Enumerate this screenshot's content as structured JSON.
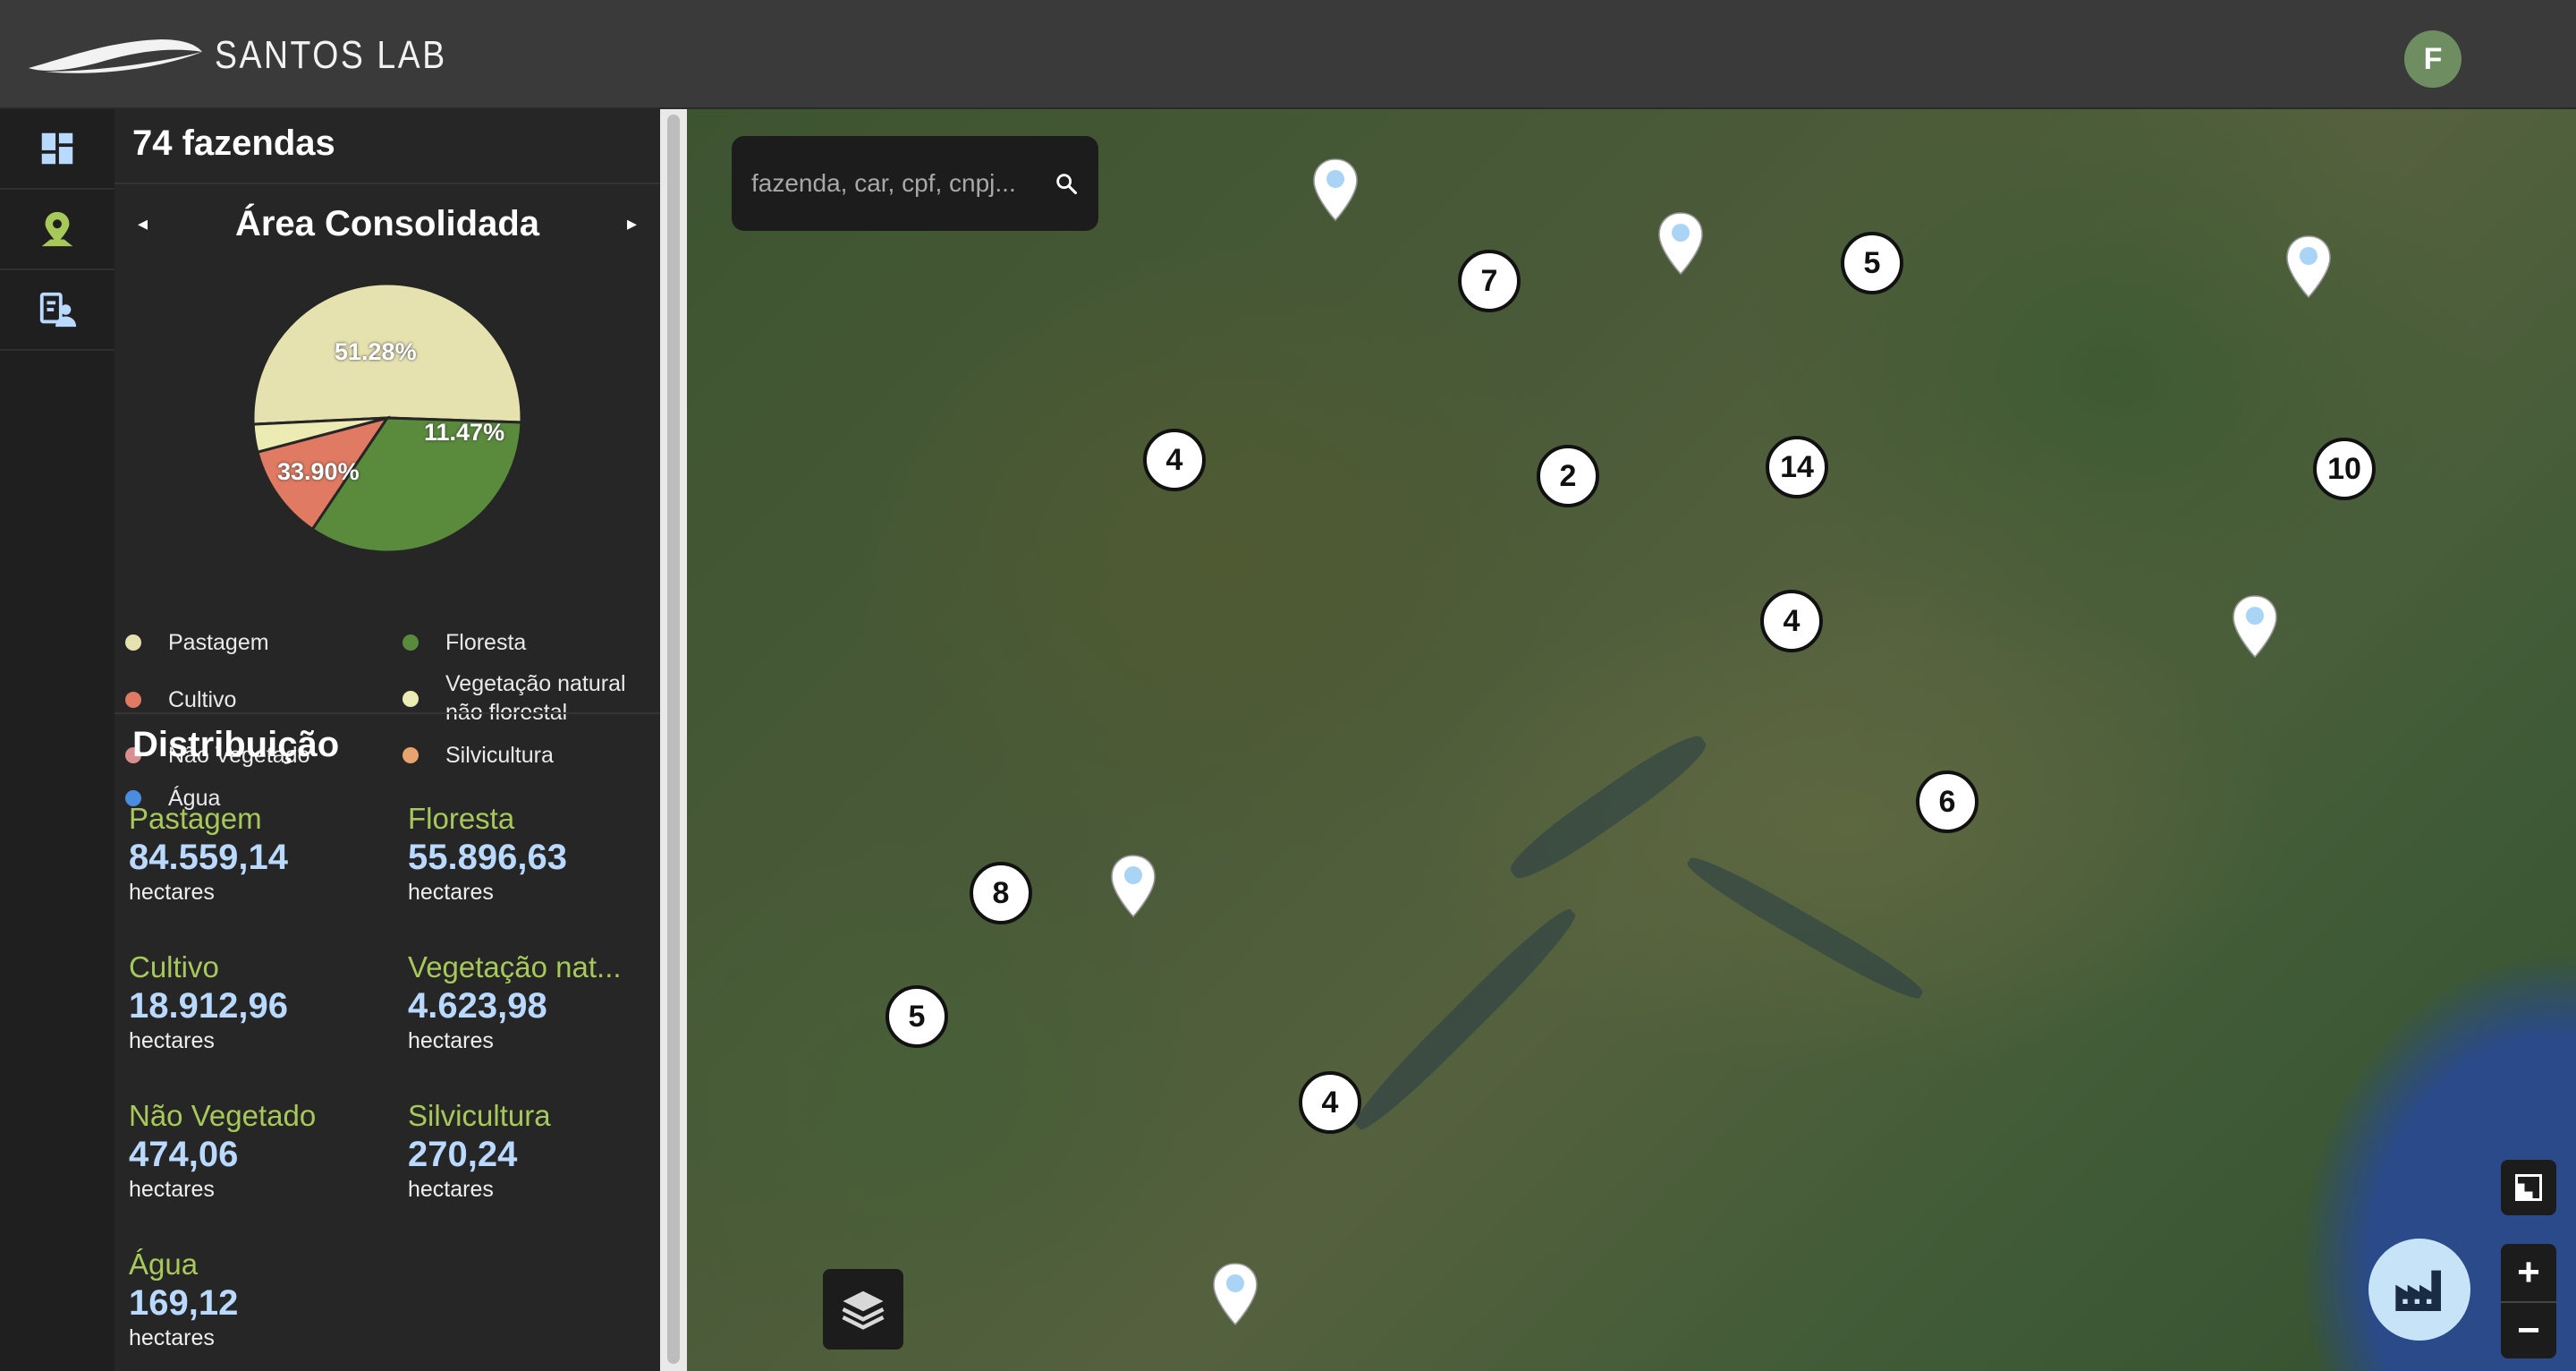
{
  "app": {
    "brand": "SANTOS LAB",
    "user_initial": "F"
  },
  "rail": {
    "items": [
      "dashboard-icon",
      "map-pin-icon",
      "client-list-icon"
    ]
  },
  "panel": {
    "count_label": "74 fazendas",
    "carousel_title": "Área Consolidada",
    "prev_arrow": "◂",
    "next_arrow": "▸",
    "legend": [
      {
        "label": "Pastagem",
        "color": "#e6e2b0"
      },
      {
        "label": "Floresta",
        "color": "#5a8a3c"
      },
      {
        "label": "Cultivo",
        "color": "#e07a62"
      },
      {
        "label": "Vegetação natural não florestal",
        "color": "#ecebb4"
      },
      {
        "label": "Não Vegetado",
        "color": "#d98f8f"
      },
      {
        "label": "Silvicultura",
        "color": "#e8a36e"
      },
      {
        "label": "Água",
        "color": "#4a8de0"
      }
    ],
    "distribution_title": "Distribuição",
    "stats": [
      {
        "name": "Pastagem",
        "value": "84.559,14",
        "unit": "hectares"
      },
      {
        "name": "Floresta",
        "value": "55.896,63",
        "unit": "hectares"
      },
      {
        "name": "Cultivo",
        "value": "18.912,96",
        "unit": "hectares"
      },
      {
        "name": "Vegetação nat...",
        "value": "4.623,98",
        "unit": "hectares"
      },
      {
        "name": "Não Vegetado",
        "value": "474,06",
        "unit": "hectares"
      },
      {
        "name": "Silvicultura",
        "value": "270,24",
        "unit": "hectares"
      },
      {
        "name": "Água",
        "value": "169,12",
        "unit": "hectares"
      }
    ]
  },
  "chart_data": {
    "type": "pie",
    "categories": [
      "Pastagem",
      "Floresta",
      "Cultivo",
      "Vegetação natural não florestal"
    ],
    "values": [
      51.28,
      33.9,
      11.47,
      3.35
    ],
    "labels": [
      "51.28%",
      "33.90%",
      "11.47%",
      ""
    ],
    "colors": [
      "#e6e2b0",
      "#5a8a3c",
      "#e07a62",
      "#ecebb4"
    ]
  },
  "map": {
    "search_placeholder": "fazenda, car, cpf, cnpj...",
    "clusters": [
      "7",
      "5",
      "4",
      "2",
      "14",
      "10",
      "4",
      "6",
      "8",
      "5",
      "4"
    ],
    "zoom_in": "+",
    "zoom_out": "−"
  }
}
